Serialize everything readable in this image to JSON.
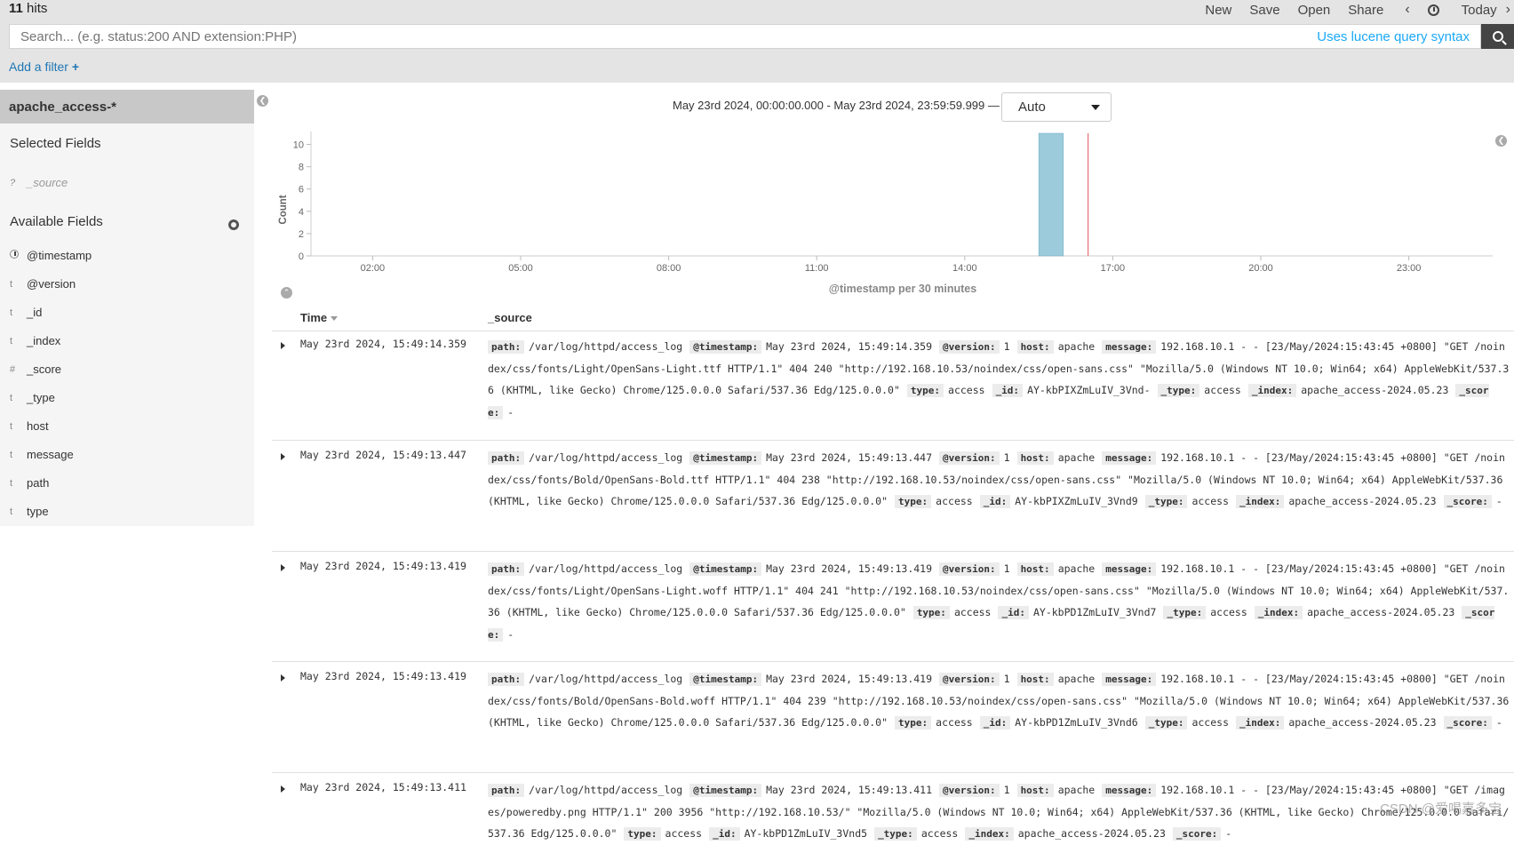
{
  "header": {
    "hits_count": "11",
    "hits_label": "hits",
    "menu": [
      "New",
      "Save",
      "Open",
      "Share"
    ],
    "prev_icon": "chevron-left-icon",
    "today_label": "Today",
    "next_icon": "chevron-right-icon"
  },
  "search": {
    "placeholder": "Search... (e.g. status:200 AND extension:PHP)",
    "lucene_link": "Uses lucene query syntax",
    "button_icon": "search-icon"
  },
  "filter": {
    "add_label": "Add a filter",
    "add_icon": "plus-icon"
  },
  "sidebar": {
    "index_pattern": "apache_access-*",
    "selected_title": "Selected Fields",
    "selected_fields": [
      {
        "type": "?",
        "name": "_source"
      }
    ],
    "available_title": "Available Fields",
    "available_fields": [
      {
        "type": "clock",
        "name": "@timestamp"
      },
      {
        "type": "t",
        "name": "@version"
      },
      {
        "type": "t",
        "name": "_id"
      },
      {
        "type": "t",
        "name": "_index"
      },
      {
        "type": "#",
        "name": "_score"
      },
      {
        "type": "t",
        "name": "_type"
      },
      {
        "type": "t",
        "name": "host"
      },
      {
        "type": "t",
        "name": "message"
      },
      {
        "type": "t",
        "name": "path"
      },
      {
        "type": "t",
        "name": "type"
      }
    ]
  },
  "histogram": {
    "time_range": "May 23rd 2024, 00:00:00.000 - May 23rd 2024, 23:59:59.999 —",
    "interval": "Auto",
    "colors": {
      "bar": "#9ccbdb",
      "bar_stroke": "#6aa8bf",
      "now_marker": "#e8727a"
    }
  },
  "chart_data": {
    "type": "bar",
    "xlabel": "@timestamp per 30 minutes",
    "ylabel": "Count",
    "ylim": [
      0,
      11
    ],
    "yticks": [
      0,
      2,
      4,
      6,
      8,
      10
    ],
    "xlim": [
      0.75,
      24.7
    ],
    "xticks": [
      {
        "hour": 2,
        "label": "02:00"
      },
      {
        "hour": 5,
        "label": "05:00"
      },
      {
        "hour": 8,
        "label": "08:00"
      },
      {
        "hour": 11,
        "label": "11:00"
      },
      {
        "hour": 14,
        "label": "14:00"
      },
      {
        "hour": 17,
        "label": "17:00"
      },
      {
        "hour": 20,
        "label": "20:00"
      },
      {
        "hour": 23,
        "label": "23:00"
      }
    ],
    "bars": [
      {
        "start_hour": 15.5,
        "end_hour": 16.0,
        "value": 11
      }
    ],
    "now_marker_hour": 16.5
  },
  "table": {
    "col_time": "Time",
    "col_source": "_source",
    "rows": [
      {
        "time": "May 23rd 2024, 15:49:14.359",
        "fields": [
          [
            "path:",
            "/var/log/httpd/access_log"
          ],
          [
            "@timestamp:",
            "May 23rd 2024, 15:49:14.359"
          ],
          [
            "@version:",
            "1"
          ],
          [
            "host:",
            "apache"
          ],
          [
            "message:",
            "192.168.10.1 - - [23/May/2024:15:43:45 +0800] \"GET /noindex/css/fonts/Light/OpenSans-Light.ttf HTTP/1.1\" 404 240 \"http://192.168.10.53/noindex/css/open-sans.css\" \"Mozilla/5.0 (Windows NT 10.0; Win64; x64) AppleWebKit/537.36 (KHTML, like Gecko) Chrome/125.0.0.0 Safari/537.36 Edg/125.0.0.0\""
          ],
          [
            "type:",
            "access"
          ],
          [
            "_id:",
            "AY-kbPIXZmLuIV_3Vnd-"
          ],
          [
            "_type:",
            "access"
          ],
          [
            "_index:",
            "apache_access-2024.05.23"
          ],
          [
            "_score:",
            "-"
          ]
        ]
      },
      {
        "time": "May 23rd 2024, 15:49:13.447",
        "fields": [
          [
            "path:",
            "/var/log/httpd/access_log"
          ],
          [
            "@timestamp:",
            "May 23rd 2024, 15:49:13.447"
          ],
          [
            "@version:",
            "1"
          ],
          [
            "host:",
            "apache"
          ],
          [
            "message:",
            "192.168.10.1 - - [23/May/2024:15:43:45 +0800] \"GET /noindex/css/fonts/Bold/OpenSans-Bold.ttf HTTP/1.1\" 404 238 \"http://192.168.10.53/noindex/css/open-sans.css\" \"Mozilla/5.0 (Windows NT 10.0; Win64; x64) AppleWebKit/537.36 (KHTML, like Gecko) Chrome/125.0.0.0 Safari/537.36 Edg/125.0.0.0\""
          ],
          [
            "type:",
            "access"
          ],
          [
            "_id:",
            "AY-kbPIXZmLuIV_3Vnd9"
          ],
          [
            "_type:",
            "access"
          ],
          [
            "_index:",
            "apache_access-2024.05.23"
          ],
          [
            "_score:",
            "-"
          ]
        ]
      },
      {
        "time": "May 23rd 2024, 15:49:13.419",
        "fields": [
          [
            "path:",
            "/var/log/httpd/access_log"
          ],
          [
            "@timestamp:",
            "May 23rd 2024, 15:49:13.419"
          ],
          [
            "@version:",
            "1"
          ],
          [
            "host:",
            "apache"
          ],
          [
            "message:",
            "192.168.10.1 - - [23/May/2024:15:43:45 +0800] \"GET /noindex/css/fonts/Light/OpenSans-Light.woff HTTP/1.1\" 404 241 \"http://192.168.10.53/noindex/css/open-sans.css\" \"Mozilla/5.0 (Windows NT 10.0; Win64; x64) AppleWebKit/537.36 (KHTML, like Gecko) Chrome/125.0.0.0 Safari/537.36 Edg/125.0.0.0\""
          ],
          [
            "type:",
            "access"
          ],
          [
            "_id:",
            "AY-kbPD1ZmLuIV_3Vnd7"
          ],
          [
            "_type:",
            "access"
          ],
          [
            "_index:",
            "apache_access-2024.05.23"
          ],
          [
            "_score:",
            "-"
          ]
        ]
      },
      {
        "time": "May 23rd 2024, 15:49:13.419",
        "fields": [
          [
            "path:",
            "/var/log/httpd/access_log"
          ],
          [
            "@timestamp:",
            "May 23rd 2024, 15:49:13.419"
          ],
          [
            "@version:",
            "1"
          ],
          [
            "host:",
            "apache"
          ],
          [
            "message:",
            "192.168.10.1 - - [23/May/2024:15:43:45 +0800] \"GET /noindex/css/fonts/Bold/OpenSans-Bold.woff HTTP/1.1\" 404 239 \"http://192.168.10.53/noindex/css/open-sans.css\" \"Mozilla/5.0 (Windows NT 10.0; Win64; x64) AppleWebKit/537.36 (KHTML, like Gecko) Chrome/125.0.0.0 Safari/537.36 Edg/125.0.0.0\""
          ],
          [
            "type:",
            "access"
          ],
          [
            "_id:",
            "AY-kbPD1ZmLuIV_3Vnd6"
          ],
          [
            "_type:",
            "access"
          ],
          [
            "_index:",
            "apache_access-2024.05.23"
          ],
          [
            "_score:",
            "-"
          ]
        ]
      },
      {
        "time": "May 23rd 2024, 15:49:13.411",
        "fields": [
          [
            "path:",
            "/var/log/httpd/access_log"
          ],
          [
            "@timestamp:",
            "May 23rd 2024, 15:49:13.411"
          ],
          [
            "@version:",
            "1"
          ],
          [
            "host:",
            "apache"
          ],
          [
            "message:",
            "192.168.10.1 - - [23/May/2024:15:43:45 +0800] \"GET /images/poweredby.png HTTP/1.1\" 200 3956 \"http://192.168.10.53/\" \"Mozilla/5.0 (Windows NT 10.0; Win64; x64) AppleWebKit/537.36 (KHTML, like Gecko) Chrome/125.0.0.0 Safari/537.36 Edg/125.0.0.0\""
          ],
          [
            "type:",
            "access"
          ],
          [
            "_id:",
            "AY-kbPD1ZmLuIV_3Vnd5"
          ],
          [
            "_type:",
            "access"
          ],
          [
            "_index:",
            "apache_access-2024.05.23"
          ],
          [
            "_score:",
            "-"
          ]
        ]
      }
    ]
  },
  "watermark": "CSDN @爱喝嘉多宝"
}
